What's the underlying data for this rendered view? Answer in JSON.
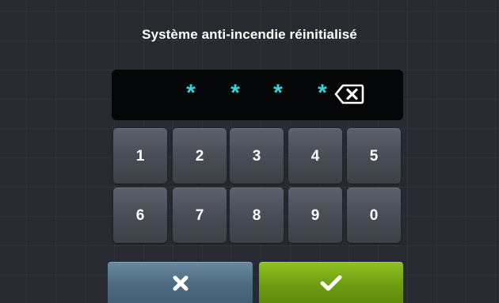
{
  "dialog": {
    "title": "Système anti-incendie réinitialisé"
  },
  "pin_display": {
    "masked_digits": [
      "*",
      "*",
      "*",
      "*"
    ],
    "digit_color": "#38d2dc",
    "backspace_icon": "backspace-icon"
  },
  "keypad": {
    "row1": [
      "1",
      "2",
      "3",
      "4",
      "5"
    ],
    "row2": [
      "6",
      "7",
      "8",
      "9",
      "0"
    ]
  },
  "actions": {
    "cancel_icon": "close-icon",
    "confirm_icon": "checkmark-icon",
    "cancel_color": "#4d6a80",
    "confirm_color": "#6f9d12"
  }
}
